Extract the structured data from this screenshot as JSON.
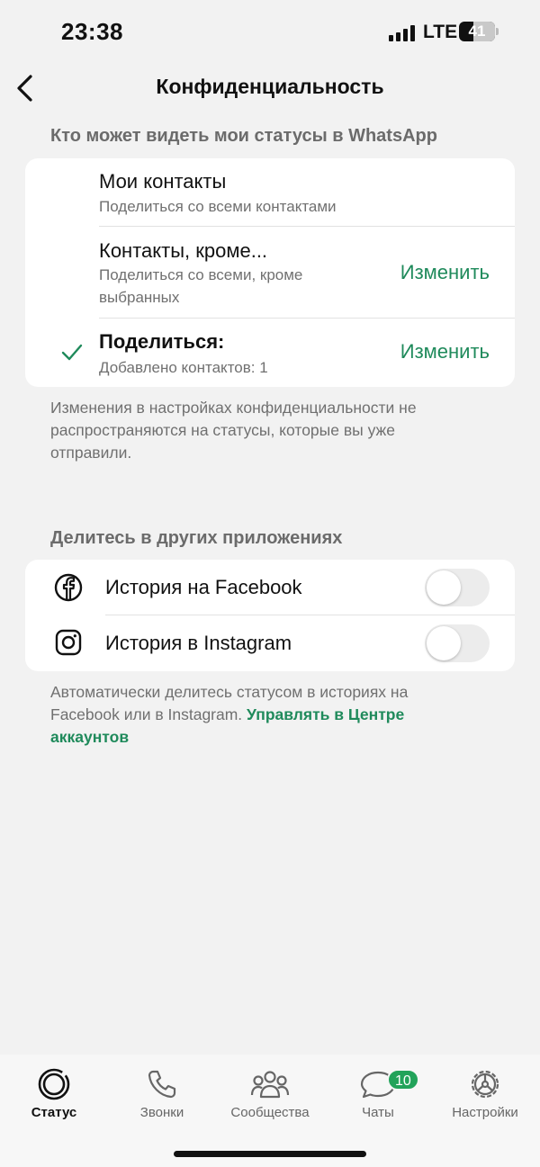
{
  "status_bar": {
    "time": "23:38",
    "network": "LTE",
    "battery": "41"
  },
  "header": {
    "title": "Конфиденциальность",
    "back_icon": "chevron-left-icon"
  },
  "who_can_see": {
    "section_title": "Кто может видеть мои статусы в WhatsApp",
    "options": [
      {
        "title": "Мои контакты",
        "subtitle": "Поделиться со всеми контактами",
        "selected": false
      },
      {
        "title": "Контакты, кроме...",
        "subtitle": "Поделиться со всеми, кроме выбранных",
        "action": "Изменить",
        "selected": false
      },
      {
        "title": "Поделиться:",
        "subtitle": "Добавлено контактов: 1",
        "action": "Изменить",
        "selected": true
      }
    ],
    "footnote": "Изменения в настройках конфиденциальности не распространяются на статусы, которые вы уже отправили."
  },
  "share_other_apps": {
    "section_title": "Делитесь в других приложениях",
    "items": [
      {
        "label": "История на Facebook",
        "icon": "facebook-icon",
        "enabled": false
      },
      {
        "label": "История в Instagram",
        "icon": "instagram-icon",
        "enabled": false
      }
    ],
    "footnote_text": "Автоматически делитесь статусом в историях на Facebook или в Instagram.",
    "footnote_link": "Управлять в Центре аккаунтов"
  },
  "tabbar": {
    "tabs": [
      {
        "label": "Статус",
        "icon": "status-icon",
        "active": true
      },
      {
        "label": "Звонки",
        "icon": "phone-icon",
        "active": false
      },
      {
        "label": "Сообщества",
        "icon": "communities-icon",
        "active": false
      },
      {
        "label": "Чаты",
        "icon": "chats-icon",
        "active": false,
        "badge": "10"
      },
      {
        "label": "Настройки",
        "icon": "settings-gear-icon",
        "active": false
      }
    ]
  },
  "colors": {
    "accent": "#1f8a5b",
    "badge": "#22a35a",
    "background": "#f2f2f2"
  }
}
